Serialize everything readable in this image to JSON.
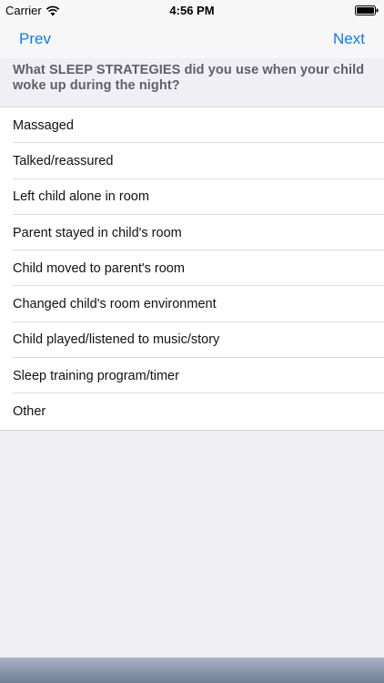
{
  "status_bar": {
    "carrier": "Carrier",
    "time": "4:56 PM"
  },
  "nav": {
    "prev_label": "Prev",
    "next_label": "Next",
    "accent_color": "#0a7bff"
  },
  "question": {
    "text": "What SLEEP STRATEGIES did you use when your child woke up during the night?"
  },
  "options": [
    {
      "label": "Massaged"
    },
    {
      "label": "Talked/reassured"
    },
    {
      "label": "Left child alone in room"
    },
    {
      "label": "Parent stayed in child's room"
    },
    {
      "label": "Child moved to parent's room"
    },
    {
      "label": "Changed child's room environment"
    },
    {
      "label": "Child played/listened to music/story"
    },
    {
      "label": "Sleep training program/timer"
    },
    {
      "label": "Other"
    }
  ]
}
